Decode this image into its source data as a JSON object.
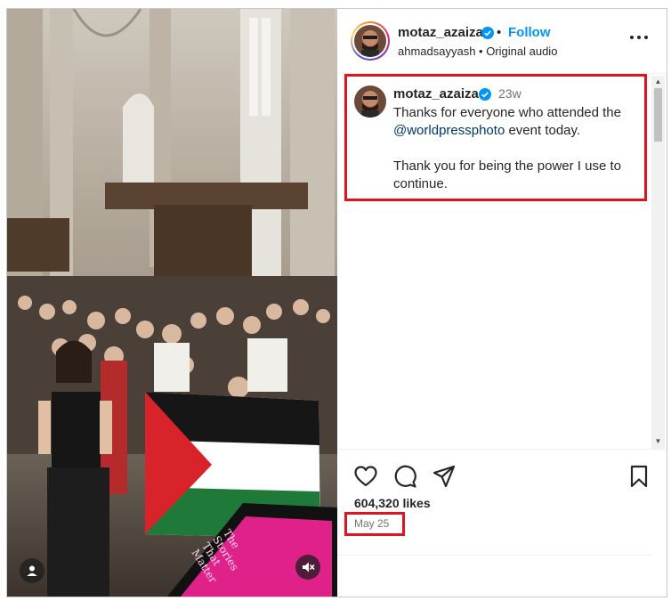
{
  "media": {
    "sign_text": [
      "The",
      "Stories",
      "That",
      "Matter"
    ],
    "user_tag_icon": "person-icon",
    "mute_icon": "speaker-muted-icon"
  },
  "header": {
    "username": "motaz_azaiza",
    "separator": "•",
    "follow_label": "Follow",
    "subtitle": "ahmadsayyash • Original audio",
    "more_icon": "ellipsis-icon"
  },
  "caption": {
    "username": "motaz_azaiza",
    "time_ago": "23w",
    "line1_prefix": "Thanks for everyone who attended the",
    "mention": "@worldpressphoto",
    "line1_suffix": " event today.",
    "line2": "Thank you for being the power I use to continue."
  },
  "actions": {
    "like_icon": "heart-icon",
    "comment_icon": "comment-icon",
    "share_icon": "paper-plane-icon",
    "save_icon": "bookmark-icon",
    "likes_text": "604,320 likes",
    "date": "May 25"
  },
  "colors": {
    "accent": "#0095f6",
    "highlight": "#e0141e",
    "flag_red": "#d8232a",
    "flag_green": "#1f7a3a"
  }
}
